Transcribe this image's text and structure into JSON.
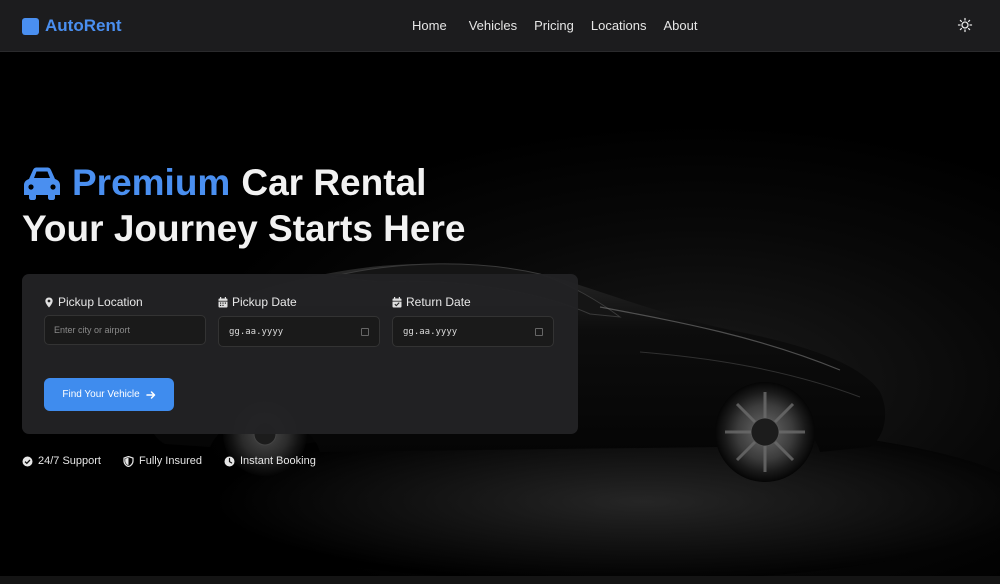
{
  "brand": {
    "name": "AutoRent",
    "color": "#4a8ff0",
    "logo_icon": "square-logo"
  },
  "nav": {
    "items": [
      {
        "label": "Home"
      },
      {
        "label": "Vehicles"
      },
      {
        "label": "Pricing"
      },
      {
        "label": "Locations"
      },
      {
        "label": "About"
      }
    ],
    "theme_toggle_icon": "sun-icon"
  },
  "hero": {
    "title_accent": "Premium",
    "title_rest": "Car Rental",
    "subtitle": "Your Journey Starts Here",
    "title_icon": "car-icon",
    "background": "dark photo of a black sports car"
  },
  "booking": {
    "pickup_location": {
      "label": "Pickup Location",
      "placeholder": "Enter city or airport",
      "value": "",
      "icon": "map-pin-icon"
    },
    "pickup_date": {
      "label": "Pickup Date",
      "value": "gg.aa.yyyy",
      "icon": "calendar-icon"
    },
    "return_date": {
      "label": "Return Date",
      "value": "gg.aa.yyyy",
      "icon": "calendar-check-icon"
    },
    "submit_label": "Find Your Vehicle",
    "submit_icon": "arrow-right-icon"
  },
  "features": [
    {
      "label": "24/7 Support",
      "icon": "check-circle-icon"
    },
    {
      "label": "Fully Insured",
      "icon": "shield-icon"
    },
    {
      "label": "Instant Booking",
      "icon": "clock-icon"
    }
  ],
  "colors": {
    "accent": "#4a8ff0",
    "button": "#3f8cee",
    "navbar_bg": "#1c1c1e",
    "panel_bg": "#222224",
    "page_bg": "#000000"
  }
}
